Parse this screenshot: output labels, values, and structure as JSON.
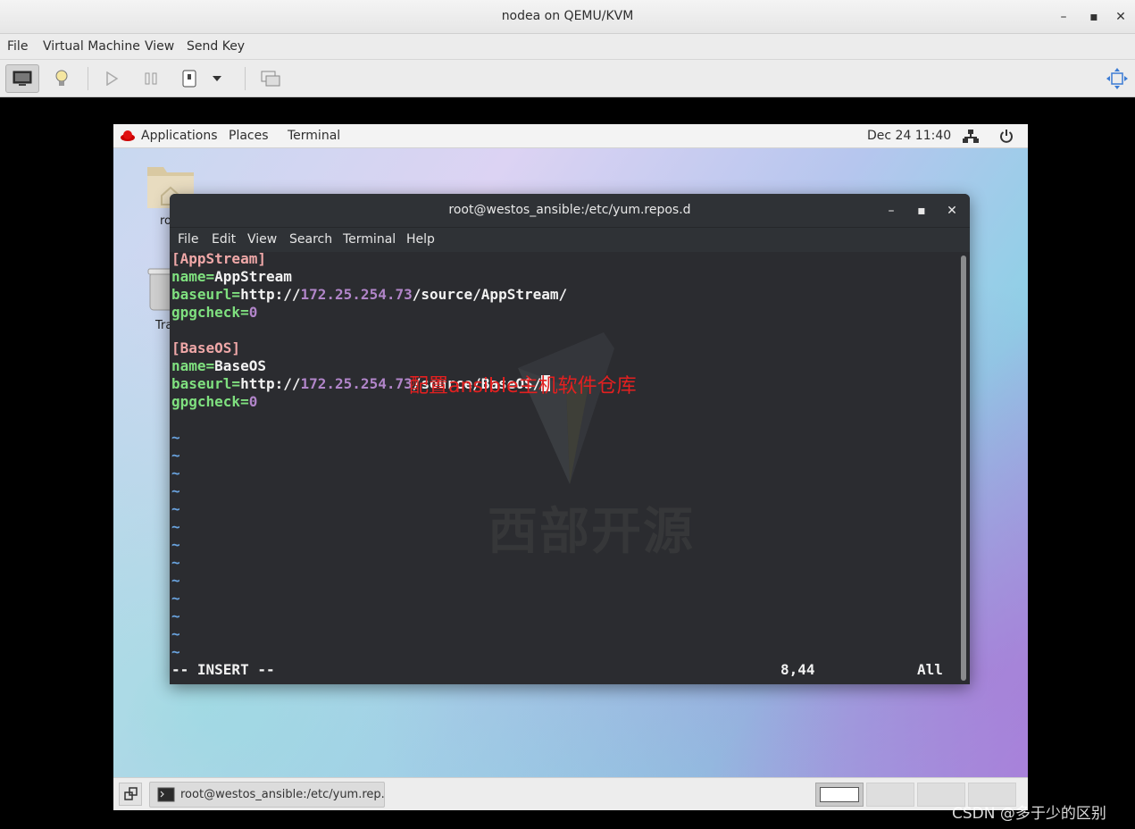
{
  "host": {
    "title": "nodea on QEMU/KVM",
    "menu": [
      "File",
      "Virtual Machine",
      "View",
      "Send Key"
    ]
  },
  "guest": {
    "topbar": {
      "applications": "Applications",
      "places": "Places",
      "terminal": "Terminal",
      "clock": "Dec 24  11:40"
    },
    "desktop": {
      "home_label": "ro",
      "trash_label": "Trash"
    },
    "terminal": {
      "title": "root@westos_ansible:/etc/yum.repos.d",
      "menu": [
        "File",
        "Edit",
        "View",
        "Search",
        "Terminal",
        "Help"
      ],
      "lines": [
        {
          "section": "[AppStream]"
        },
        {
          "key": "name=",
          "value": "AppStream"
        },
        {
          "key": "baseurl=",
          "pre": "http://",
          "ip": "172.25.254.73",
          "post": "/source/AppStream/"
        },
        {
          "key": "gpgcheck=",
          "num": "0"
        },
        {
          "section": "[BaseOS]"
        },
        {
          "key": "name=",
          "value": "BaseOS"
        },
        {
          "key": "baseurl=",
          "pre": "http://",
          "ip": "172.25.254.73",
          "post": "/source/BaseOS/"
        },
        {
          "key": "gpgcheck=",
          "num": "0"
        }
      ],
      "tilde": "~",
      "status_mode": "-- INSERT --",
      "status_pos": "8,44",
      "status_all": "All",
      "annotation": "配置ansible主机软件仓库",
      "logo_text": "西部开源"
    },
    "taskbar": {
      "task_label": "root@westos_ansible:/etc/yum.rep..."
    }
  },
  "watermark": "CSDN @多于少的区别",
  "colors": {
    "section": "#f0a8a8",
    "key": "#7fe07f",
    "number": "#b185c9",
    "tilde": "#6aa4e0",
    "annotation": "#e32020"
  }
}
